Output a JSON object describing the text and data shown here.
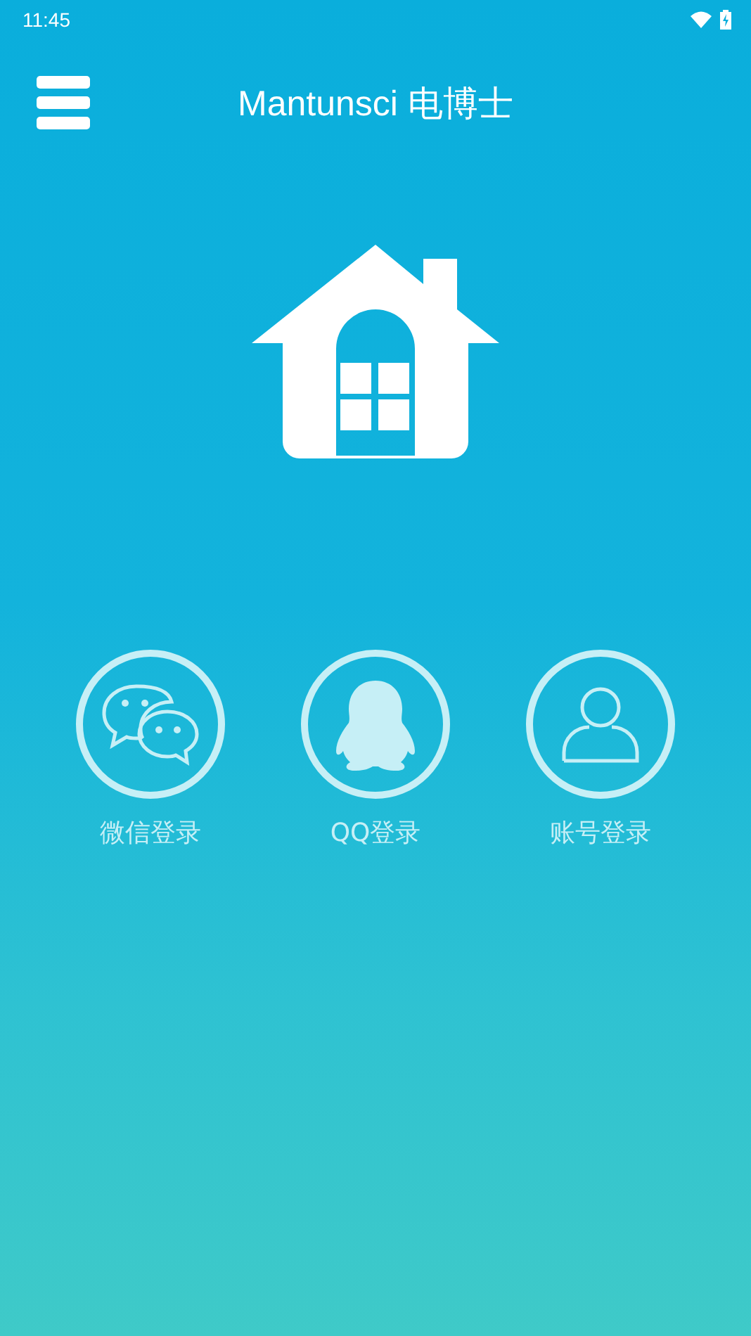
{
  "status_bar": {
    "time": "11:45"
  },
  "app_bar": {
    "title": "Mantunsci 电博士"
  },
  "login_options": [
    {
      "kind": "wechat",
      "label": "微信登录"
    },
    {
      "kind": "qq",
      "label": "QQ登录"
    },
    {
      "kind": "account",
      "label": "账号登录"
    }
  ]
}
